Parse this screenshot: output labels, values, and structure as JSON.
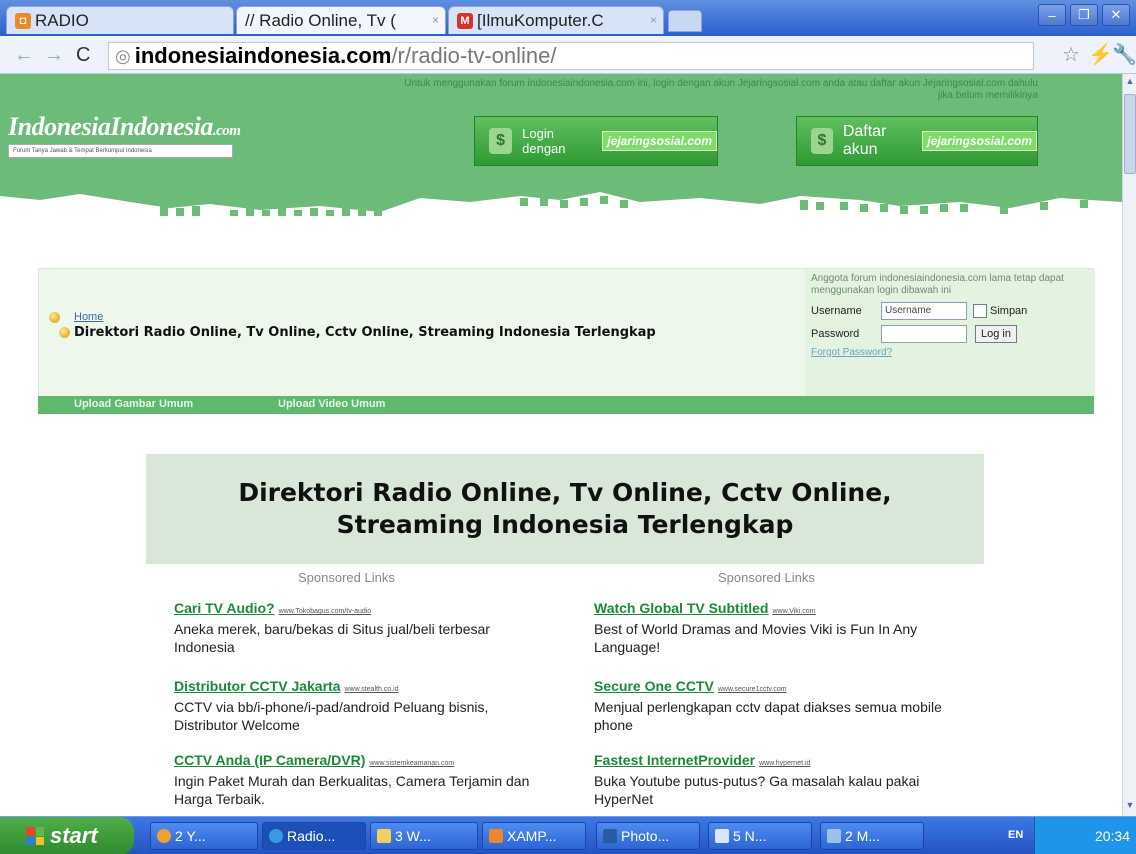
{
  "browser": {
    "tabs": [
      {
        "label": "RADIO",
        "active": false
      },
      {
        "label": "// Radio Online, Tv (",
        "active": true
      },
      {
        "label": "[IlmuKomputer.C",
        "active": false
      }
    ],
    "url_host": "indonesiaindonesia.com",
    "url_path": "/r/radio-tv-online/"
  },
  "banner": {
    "notice": "Untuk menggunakan forum indonesiaindonesia.com ini, login dengan akun Jejaringsosial.com anda atau daftar akun Jejaringsosial.com dahulu jika belum memilikinya",
    "logo": "IndonesiaIndonesia",
    "logo_suffix": ".com",
    "tagline": "Forum Tanya Jawab & Tempat Berkumpul Indonesia",
    "login_button": "Login dengan",
    "register_button": "Daftar akun",
    "badge": "jejaringsosial.com"
  },
  "forum": {
    "home_link": "Home",
    "page_title": "Direktori Radio Online, Tv Online, Cctv Online, Streaming Indonesia Terlengkap",
    "login": {
      "message": "Anggota forum indonesiaindonesia.com lama tetap dapat menggunakan login dibawah ini",
      "username_label": "Username",
      "username_value": "Username",
      "remember_label": "Simpan",
      "password_label": "Password",
      "login_button": "Log in",
      "forgot": "Forgot Password?"
    },
    "nav": [
      "Upload Gambar Umum",
      "Upload Video Umum"
    ]
  },
  "directory": {
    "title": "Direktori Radio Online, Tv Online, Cctv Online, Streaming Indonesia Terlengkap",
    "sponsored_label": "Sponsored Links",
    "ads_left": [
      {
        "title": "Cari TV Audio?",
        "url": "www.Tokobagus.com/tv-audio",
        "desc": "Aneka merek, baru/bekas di Situs jual/beli terbesar Indonesia"
      },
      {
        "title": "Distributor CCTV Jakarta",
        "url": "www.stealth.co.id",
        "desc": "CCTV via bb/i-phone/i-pad/android Peluang bisnis, Distributor Welcome"
      },
      {
        "title": "CCTV Anda (IP Camera/DVR)",
        "url": "www.sistemkeamanan.com",
        "desc": "Ingin Paket Murah dan Berkualitas, Camera Terjamin dan Harga Terbaik."
      }
    ],
    "ads_right": [
      {
        "title": "Watch Global TV Subtitled",
        "url": "www.Viki.com",
        "desc": "Best of World Dramas and Movies Viki is Fun In Any Language!"
      },
      {
        "title": "Secure One CCTV",
        "url": "www.secure1cctv.com",
        "desc": "Menjual perlengkapan cctv dapat diakses semua mobile phone"
      },
      {
        "title": "Fastest InternetProvider",
        "url": "www.hypernet.id",
        "desc": "Buka Youtube putus-putus? Ga masalah kalau pakai HyperNet"
      }
    ]
  },
  "taskbar": {
    "start": "start",
    "items": [
      "2 Y...",
      "Radio...",
      "3 W...",
      "XAMP...",
      "Photo...",
      "5 N...",
      "2 M..."
    ],
    "lang": "EN",
    "clock": "20:34"
  }
}
